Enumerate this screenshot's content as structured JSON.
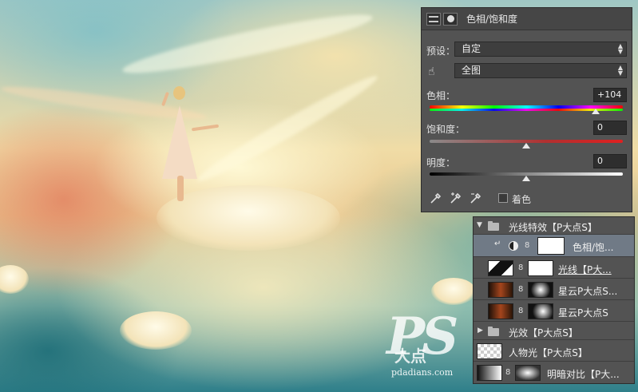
{
  "properties_panel": {
    "title": "色相/饱和度",
    "preset_label": "预设：",
    "preset_value": "自定",
    "channel_value": "全图",
    "hue_label": "色相：",
    "hue_value": "+104",
    "hue_level": 0.86,
    "saturation_label": "饱和度：",
    "saturation_value": "0",
    "saturation_level": 0.5,
    "lightness_label": "明度：",
    "lightness_value": "0",
    "lightness_level": 0.5,
    "colorize_label": "着色",
    "colorize_checked": false
  },
  "layers_panel": {
    "layers": [
      {
        "name": "光线特效【P大点S】",
        "kind": "group",
        "expanded": true
      },
      {
        "name": "色相/饱...",
        "kind": "adjustment",
        "selected": true
      },
      {
        "name": "光线【P大...",
        "kind": "layer"
      },
      {
        "name": "星云P大点S...",
        "kind": "layer"
      },
      {
        "name": "星云P大点S",
        "kind": "layer"
      },
      {
        "name": "光效【P大点S】",
        "kind": "group",
        "expanded": false
      },
      {
        "name": "人物光【P大点S】",
        "kind": "layer"
      },
      {
        "name": "明暗对比【P大...",
        "kind": "layer"
      }
    ]
  },
  "watermark": {
    "logo": "PS",
    "cn": "大点",
    "url": "pdadians.com"
  },
  "colors": {
    "panel_bg": "#535353",
    "panel_header": "#464646",
    "selected_row": "#707a86",
    "input_bg": "#2e2e2e"
  }
}
